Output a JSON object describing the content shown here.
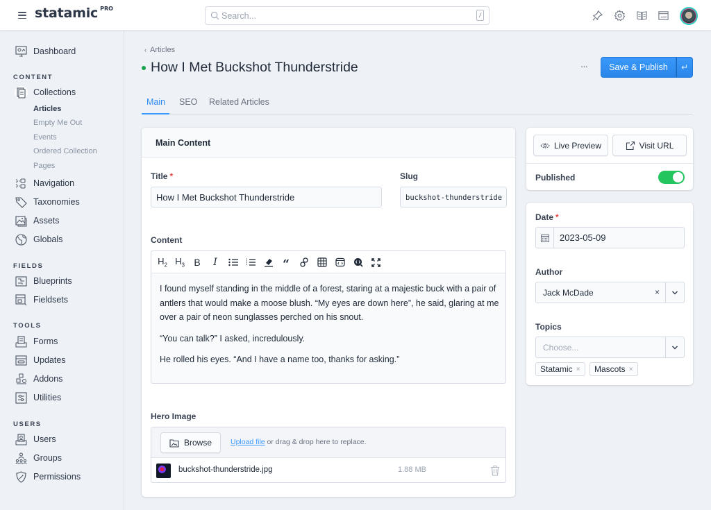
{
  "topbar": {
    "logo": "statamic",
    "logo_badge": "PRO",
    "search_placeholder": "Search...",
    "search_shortcut": "/",
    "icons": [
      "pin-icon",
      "gear-icon",
      "book-icon",
      "site-icon",
      "avatar"
    ]
  },
  "sidebar": {
    "dashboard": "Dashboard",
    "sections": [
      {
        "heading": "CONTENT"
      },
      {
        "heading": "FIELDS"
      },
      {
        "heading": "TOOLS"
      },
      {
        "heading": "USERS"
      }
    ],
    "items": {
      "collections": "Collections",
      "navigation": "Navigation",
      "taxonomies": "Taxonomies",
      "assets": "Assets",
      "globals": "Globals",
      "blueprints": "Blueprints",
      "fieldsets": "Fieldsets",
      "forms": "Forms",
      "updates": "Updates",
      "addons": "Addons",
      "utilities": "Utilities",
      "users": "Users",
      "groups": "Groups",
      "permissions": "Permissions"
    },
    "collections_sub": [
      "Articles",
      "Empty Me Out",
      "Events",
      "Ordered Collection",
      "Pages"
    ],
    "active_sub": "Articles"
  },
  "header": {
    "breadcrumb": "Articles",
    "title": "How I Met Buckshot Thunderstride",
    "status": "published",
    "status_color": "#16a34a",
    "more_label": "···",
    "save_label": "Save & Publish",
    "save_more_icon": "↵"
  },
  "tabs": [
    {
      "label": "Main",
      "active": true
    },
    {
      "label": "SEO",
      "active": false
    },
    {
      "label": "Related Articles",
      "active": false
    }
  ],
  "main": {
    "section_title": "Main Content",
    "title_label": "Title",
    "title_value": "How I Met Buckshot Thunderstride",
    "slug_label": "Slug",
    "slug_value": "buckshot-thunderstride",
    "content_label": "Content",
    "toolbar": [
      "H2",
      "H3",
      "B",
      "I",
      "bullet-list",
      "ordered-list",
      "clear-format",
      "quote",
      "link",
      "table",
      "code",
      "source",
      "fullscreen"
    ],
    "paragraphs": [
      "I found myself standing in the middle of a forest, staring at a majestic buck with a pair of antlers that would make a moose blush. “My eyes are down here”, he said, glaring at me over a pair of neon sunglasses perched on his snout.",
      "“You can talk?” I asked, incredulously.",
      "He rolled his eyes. “And I have a name too, thanks for asking.”"
    ],
    "hero_label": "Hero Image",
    "browse_label": "Browse",
    "upload_link": "Upload file",
    "upload_text": " or drag & drop here to replace.",
    "asset_name": "buckshot-thunderstride.jpg",
    "asset_size": "1.88 MB"
  },
  "side": {
    "live_preview": "Live Preview",
    "visit_url": "Visit URL",
    "published_label": "Published",
    "published": true,
    "toggle_color": "#22c55e",
    "date_label": "Date",
    "date_value": "2023-05-09",
    "author_label": "Author",
    "author_value": "Jack McDade",
    "clear_icon": "×",
    "topics_label": "Topics",
    "topics_placeholder": "Choose...",
    "topics": [
      "Statamic",
      "Mascots"
    ],
    "tag_remove": "×"
  },
  "colors": {
    "accent": "#2b8cf0",
    "required": "#ef4444"
  }
}
